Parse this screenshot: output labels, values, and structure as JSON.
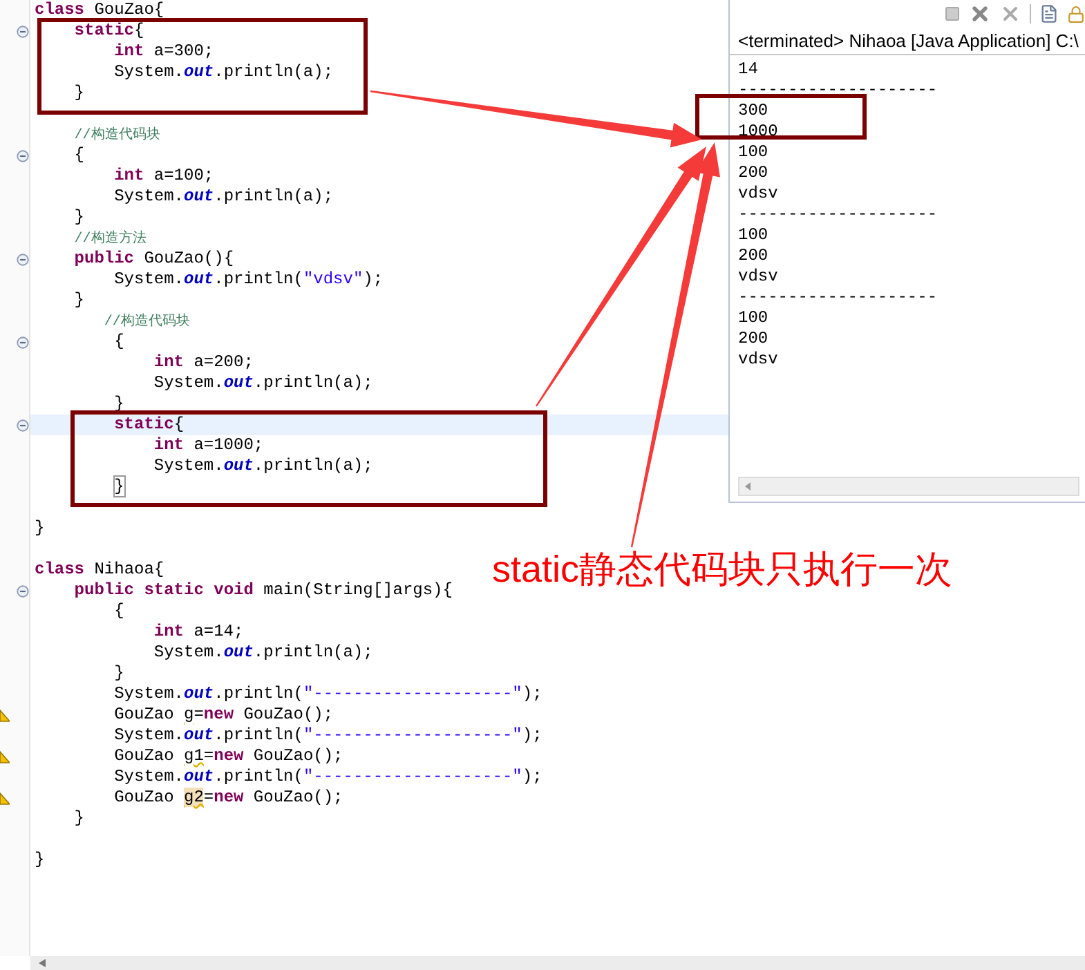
{
  "editor": {
    "lines": [
      {
        "kind": "plain",
        "tokens": [
          {
            "kind": "kw",
            "text": "class"
          },
          {
            "kind": "plain",
            "text": " GouZao{"
          }
        ],
        "current": false,
        "children": [
          {
            "kind": "fold",
            "tokens": [
              {
                "kind": "kw",
                "text": "static"
              },
              {
                "kind": "plain",
                "text": "{"
              }
            ],
            "current": false,
            "children": [
              {
                "kind": "plain",
                "tokens": [
                  {
                    "kind": "kw",
                    "text": "int"
                  },
                  {
                    "kind": "plain",
                    "text": " a=300;"
                  }
                ],
                "current": false
              },
              {
                "kind": "plain",
                "tokens": [
                  {
                    "kind": "plain",
                    "text": "System."
                  },
                  {
                    "kind": "field",
                    "text": "out"
                  },
                  {
                    "kind": "plain",
                    "text": ".println(a);"
                  }
                ],
                "current": false
              }
            ]
          },
          {
            "kind": "plain",
            "tokens": [
              {
                "kind": "plain",
                "text": "}"
              }
            ],
            "current": false
          },
          {
            "kind": "plain",
            "current": false
          },
          {
            "kind": "plain",
            "tokens": [
              {
                "kind": "comment",
                "text": "//构造代码块"
              }
            ],
            "current": false
          },
          {
            "kind": "fold",
            "tokens": [
              {
                "kind": "plain",
                "text": "{"
              }
            ],
            "current": false,
            "children": [
              {
                "kind": "plain",
                "tokens": [
                  {
                    "kind": "kw",
                    "text": "int"
                  },
                  {
                    "kind": "plain",
                    "text": " a=100;"
                  }
                ],
                "current": false
              },
              {
                "kind": "plain",
                "tokens": [
                  {
                    "kind": "plain",
                    "text": "System."
                  },
                  {
                    "kind": "field",
                    "text": "out"
                  },
                  {
                    "kind": "plain",
                    "text": ".println(a);"
                  }
                ],
                "current": false
              }
            ]
          },
          {
            "kind": "plain",
            "tokens": [
              {
                "kind": "plain",
                "text": "}"
              }
            ],
            "current": false
          },
          {
            "kind": "plain",
            "tokens": [
              {
                "kind": "comment",
                "text": "//构造方法"
              }
            ],
            "current": false
          },
          {
            "kind": "fold",
            "tokens": [
              {
                "kind": "kw",
                "text": "public"
              },
              {
                "kind": "plain",
                "text": " GouZao(){"
              }
            ],
            "current": false,
            "children": [
              {
                "kind": "plain",
                "tokens": [
                  {
                    "kind": "plain",
                    "text": "System."
                  },
                  {
                    "kind": "field",
                    "text": "out"
                  },
                  {
                    "kind": "plain",
                    "text": ".println("
                  },
                  {
                    "kind": "string",
                    "text": "\"vdsv\""
                  },
                  {
                    "kind": "plain",
                    "text": ");"
                  }
                ],
                "current": false
              }
            ]
          },
          {
            "kind": "plain",
            "tokens": [
              {
                "kind": "plain",
                "text": "}"
              }
            ],
            "current": false
          },
          {
            "kind": "shifted",
            "tokens": [
              {
                "kind": "comment",
                "text": "//构造代码块"
              }
            ],
            "current": false,
            "children": [
              {
                "kind": "fold",
                "tokens": [
                  {
                    "kind": "plain",
                    "text": "{"
                  }
                ],
                "current": false,
                "children": [
                  {
                    "kind": "plain",
                    "tokens": [
                      {
                        "kind": "kw",
                        "text": "int"
                      },
                      {
                        "kind": "plain",
                        "text": " a=200;"
                      }
                    ],
                    "current": false
                  },
                  {
                    "kind": "plain",
                    "tokens": [
                      {
                        "kind": "plain",
                        "text": "System."
                      },
                      {
                        "kind": "field",
                        "text": "out"
                      },
                      {
                        "kind": "plain",
                        "text": ".println(a);"
                      }
                    ],
                    "current": false
                  }
                ]
              },
              {
                "kind": "plain",
                "tokens": [
                  {
                    "kind": "plain",
                    "text": "}"
                  }
                ],
                "current": false
              },
              {
                "kind": "fold",
                "tokens": [
                  {
                    "kind": "kw",
                    "text": "static"
                  },
                  {
                    "kind": "plain",
                    "text": "{"
                  }
                ],
                "current": true,
                "children": [
                  {
                    "kind": "plain",
                    "tokens": [
                      {
                        "kind": "kw",
                        "text": "int"
                      },
                      {
                        "kind": "plain",
                        "text": " a=1000;"
                      }
                    ],
                    "current": false
                  },
                  {
                    "kind": "plain",
                    "tokens": [
                      {
                        "kind": "plain",
                        "text": "System."
                      },
                      {
                        "kind": "field",
                        "text": "out"
                      },
                      {
                        "kind": "plain",
                        "text": ".println(a);"
                      }
                    ],
                    "current": false
                  }
                ]
              },
              {
                "kind": "plain",
                "tokens": [
                  {
                    "kind": "bracket",
                    "text": "}"
                  }
                ],
                "current": false
              }
            ]
          },
          {
            "kind": "plain",
            "current": false
          }
        ]
      },
      {
        "kind": "plain",
        "tokens": [
          {
            "kind": "plain",
            "text": "}"
          }
        ],
        "current": false
      },
      {
        "kind": "plain",
        "current": false
      },
      {
        "kind": "plain",
        "tokens": [
          {
            "kind": "kw",
            "text": "class"
          },
          {
            "kind": "plain",
            "text": " Nihaoa{"
          }
        ],
        "current": false,
        "children": [
          {
            "kind": "fold",
            "tokens": [
              {
                "kind": "kw",
                "text": "public static void"
              },
              {
                "kind": "plain",
                "text": " main(String[]args){"
              }
            ],
            "current": false,
            "children": [
              {
                "kind": "plain",
                "tokens": [
                  {
                    "kind": "plain",
                    "text": "{"
                  }
                ],
                "current": false,
                "children": [
                  {
                    "kind": "plain",
                    "tokens": [
                      {
                        "kind": "kw",
                        "text": "int"
                      },
                      {
                        "kind": "plain",
                        "text": " a=14;"
                      }
                    ],
                    "current": false
                  },
                  {
                    "kind": "plain",
                    "tokens": [
                      {
                        "kind": "plain",
                        "text": "System."
                      },
                      {
                        "kind": "field",
                        "text": "out"
                      },
                      {
                        "kind": "plain",
                        "text": ".println(a);"
                      }
                    ],
                    "current": false
                  }
                ]
              },
              {
                "kind": "plain",
                "tokens": [
                  {
                    "kind": "plain",
                    "text": "}"
                  }
                ],
                "current": false
              },
              {
                "kind": "plain",
                "tokens": [
                  {
                    "kind": "plain",
                    "text": "System."
                  },
                  {
                    "kind": "field",
                    "text": "out"
                  },
                  {
                    "kind": "plain",
                    "text": ".println("
                  },
                  {
                    "kind": "string",
                    "text": "\"--------------------\""
                  },
                  {
                    "kind": "plain",
                    "text": ");"
                  }
                ],
                "current": false
              },
              {
                "kind": "warning",
                "tokens": [
                  {
                    "kind": "plain",
                    "text": "GouZao "
                  },
                  {
                    "kind": "warnvar",
                    "text": "g"
                  },
                  {
                    "kind": "plain",
                    "text": "="
                  },
                  {
                    "kind": "kw",
                    "text": "new"
                  },
                  {
                    "kind": "plain",
                    "text": " GouZao();"
                  }
                ],
                "current": false
              },
              {
                "kind": "plain",
                "tokens": [
                  {
                    "kind": "plain",
                    "text": "System."
                  },
                  {
                    "kind": "field",
                    "text": "out"
                  },
                  {
                    "kind": "plain",
                    "text": ".println("
                  },
                  {
                    "kind": "string",
                    "text": "\"--------------------\""
                  },
                  {
                    "kind": "plain",
                    "text": ");"
                  }
                ],
                "current": false
              },
              {
                "kind": "warning",
                "tokens": [
                  {
                    "kind": "plain",
                    "text": "GouZao "
                  },
                  {
                    "kind": "warnvar",
                    "text": "g1"
                  },
                  {
                    "kind": "plain",
                    "text": "="
                  },
                  {
                    "kind": "kw",
                    "text": "new"
                  },
                  {
                    "kind": "plain",
                    "text": " GouZao();"
                  }
                ],
                "current": false
              },
              {
                "kind": "plain",
                "tokens": [
                  {
                    "kind": "plain",
                    "text": "System."
                  },
                  {
                    "kind": "field",
                    "text": "out"
                  },
                  {
                    "kind": "plain",
                    "text": ".println("
                  },
                  {
                    "kind": "string",
                    "text": "\"--------------------\""
                  },
                  {
                    "kind": "plain",
                    "text": ");"
                  }
                ],
                "current": false
              },
              {
                "kind": "warning",
                "tokens": [
                  {
                    "kind": "plain",
                    "text": "GouZao "
                  },
                  {
                    "kind": "markedvar",
                    "text": "g2"
                  },
                  {
                    "kind": "plain",
                    "text": "="
                  },
                  {
                    "kind": "kw",
                    "text": "new"
                  },
                  {
                    "kind": "plain",
                    "text": " GouZao();"
                  }
                ],
                "current": false
              }
            ]
          },
          {
            "kind": "plain",
            "tokens": [
              {
                "kind": "plain",
                "text": "}"
              }
            ],
            "current": false
          },
          {
            "kind": "plain",
            "current": false
          }
        ]
      },
      {
        "kind": "plain",
        "tokens": [
          {
            "kind": "plain",
            "text": "}"
          }
        ],
        "current": false
      }
    ]
  },
  "console": {
    "header": "<terminated> Nihaoa [Java Application] C:\\",
    "output": [
      "14",
      "--------------------",
      "300",
      "1000",
      "100",
      "200",
      "vdsv",
      "--------------------",
      "100",
      "200",
      "vdsv",
      "--------------------",
      "100",
      "200",
      "vdsv"
    ]
  },
  "annotation": {
    "caption": "static静态代码块只执行一次"
  }
}
